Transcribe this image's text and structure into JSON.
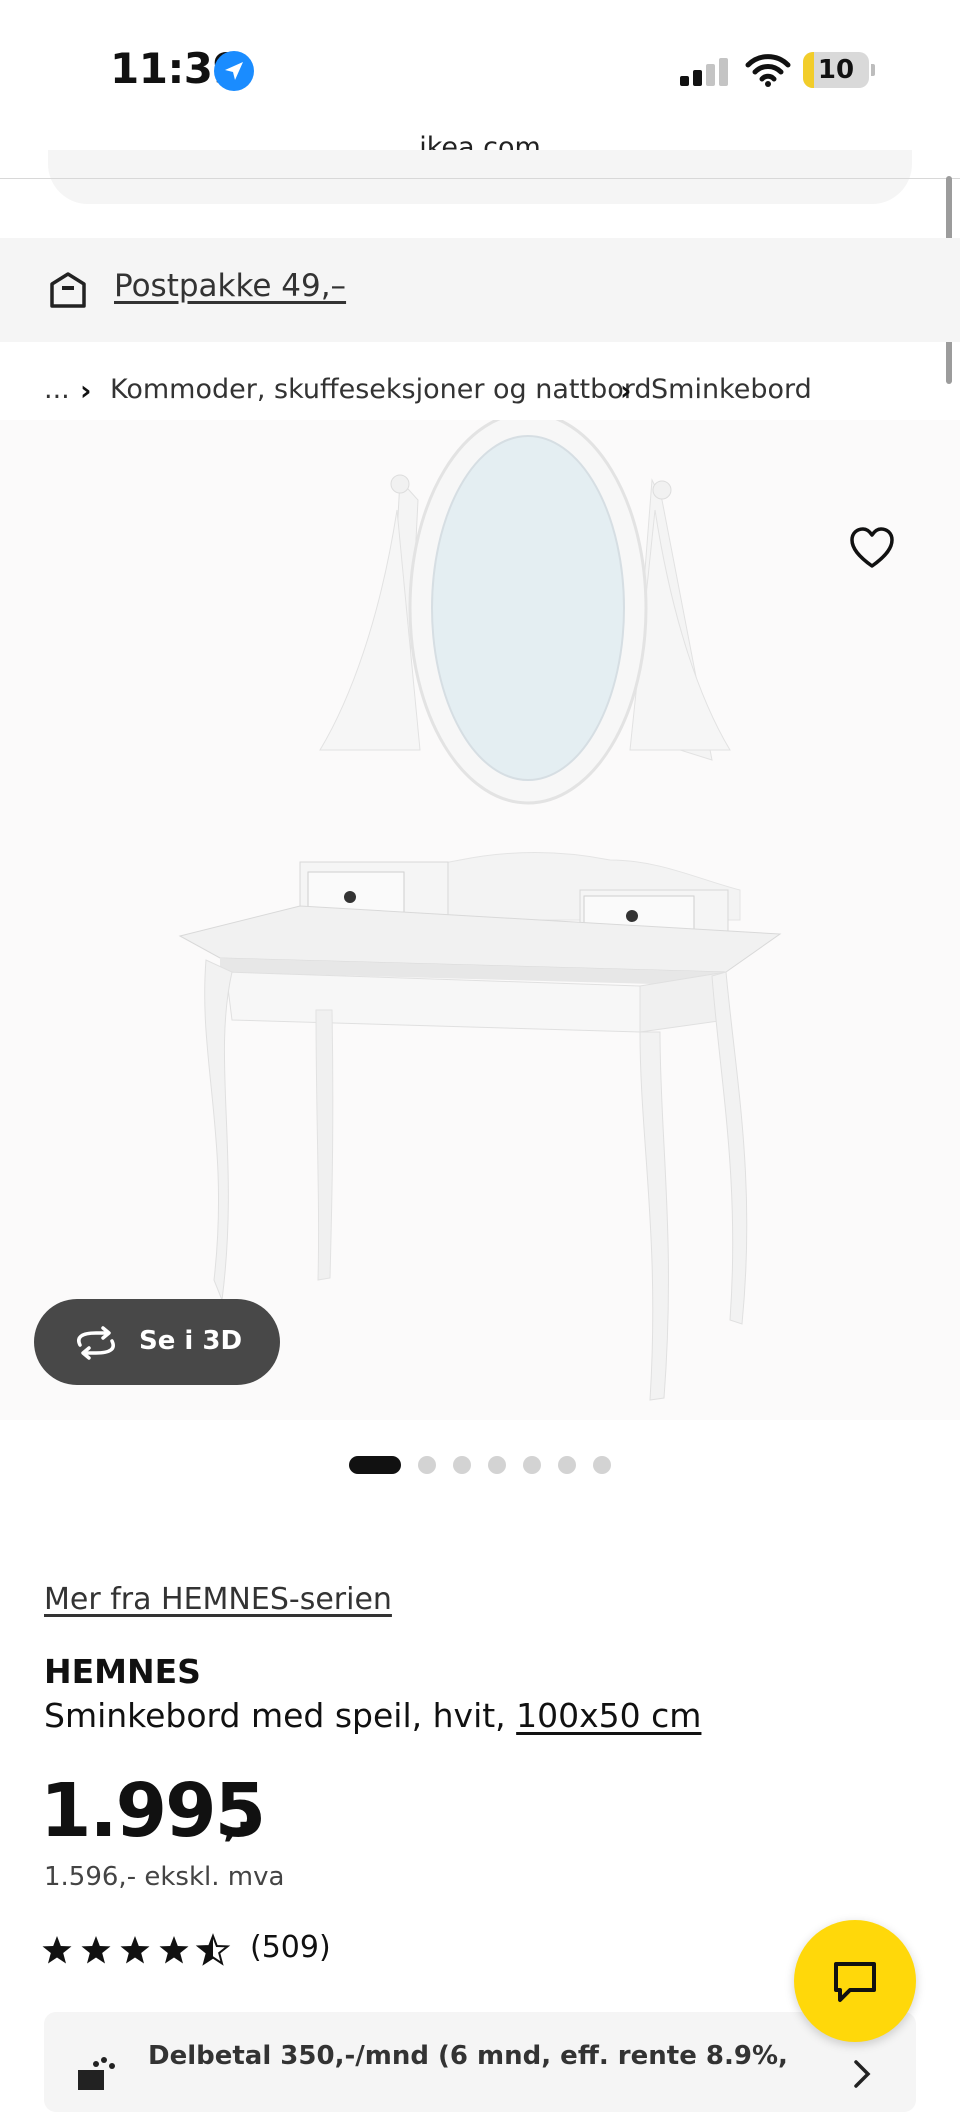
{
  "status_bar": {
    "time": "11:39",
    "battery": "10",
    "colors": {
      "location": "#1a8cff",
      "battery_fill": "#f2cd2a"
    }
  },
  "browser": {
    "domain": "ikea.com"
  },
  "delivery_banner": {
    "text": "Postpakke 49,–",
    "icon": "delivery-box-icon"
  },
  "breadcrumb": {
    "ellipsis": "...",
    "items": [
      "Kommoder, skuffeseksjoner og nattbord",
      "Sminkebord"
    ]
  },
  "gallery": {
    "image_alt": "HEMNES sminkebord med speil, hvit",
    "view_3d_label": "Se i 3D",
    "dot_count": 7,
    "active_dot": 0,
    "favourite_icon": "heart-outline-icon"
  },
  "product": {
    "series_link": "Mer fra HEMNES-serien",
    "name": "HEMNES",
    "description": "Sminkebord med speil, hvit, ",
    "size": "100x50 cm",
    "price_integer": "1.995",
    "price_suffix": ",-",
    "price_excl_vat": "1.596,- ekskl. mva",
    "rating_stars": 4.5,
    "rating_count": "(509)"
  },
  "financing": {
    "text": "Delbetal 350,-/mnd (6 mnd, eff. rente 8.9%,",
    "icon": "payment-icon"
  },
  "chat": {
    "icon": "chat-bubble-icon",
    "color": "#ffd80a"
  }
}
